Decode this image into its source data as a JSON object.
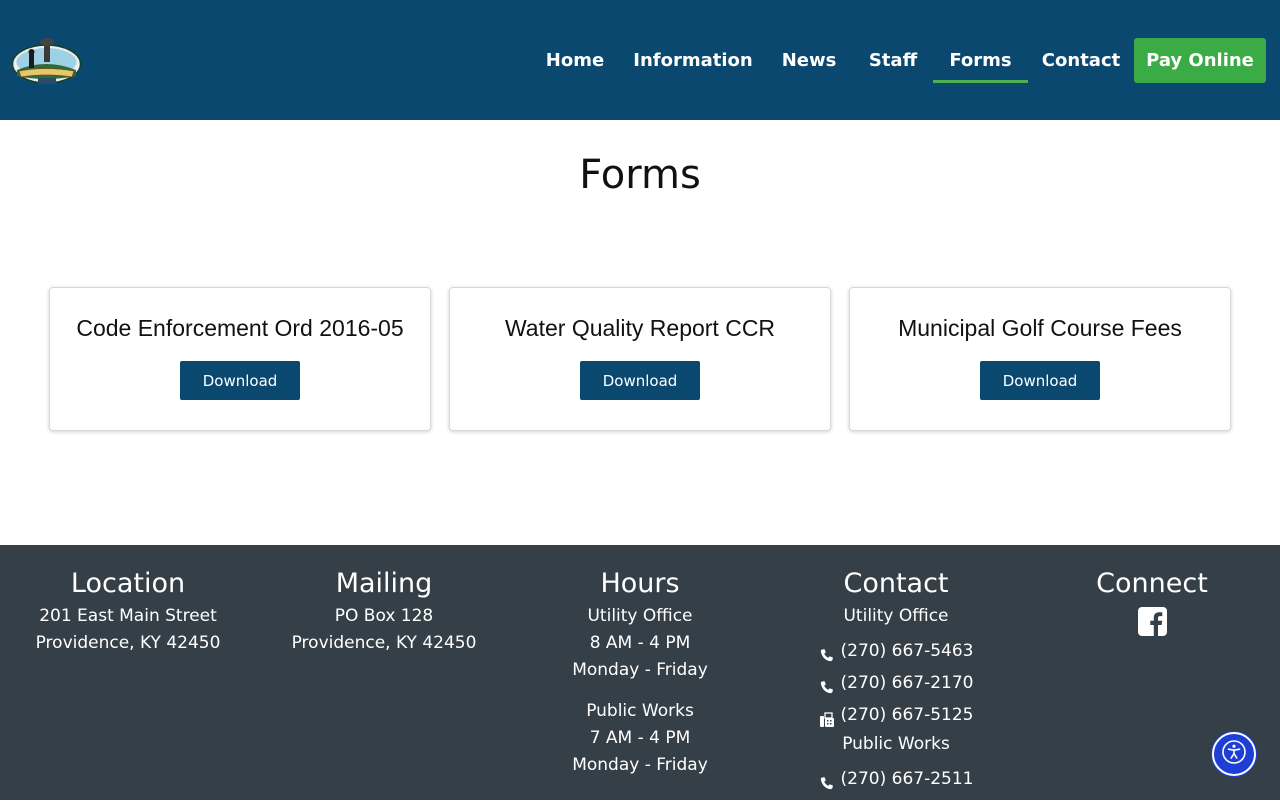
{
  "header": {
    "nav": [
      {
        "label": "Home"
      },
      {
        "label": "Information"
      },
      {
        "label": "News"
      },
      {
        "label": "Staff"
      },
      {
        "label": "Forms",
        "active": true
      },
      {
        "label": "Contact"
      }
    ],
    "pay_online": "Pay Online"
  },
  "main": {
    "title": "Forms",
    "cards": [
      {
        "title": "Code Enforcement Ord 2016-05",
        "button": "Download"
      },
      {
        "title": "Water Quality Report CCR",
        "button": "Download"
      },
      {
        "title": "Municipal Golf Course Fees",
        "button": "Download"
      }
    ]
  },
  "footer": {
    "location": {
      "heading": "Location",
      "lines": [
        "201 East Main Street",
        "Providence, KY 42450"
      ]
    },
    "mailing": {
      "heading": "Mailing",
      "lines": [
        "PO Box 128",
        "Providence, KY 42450"
      ]
    },
    "hours": {
      "heading": "Hours",
      "utility": [
        "Utility Office",
        "8 AM - 4 PM",
        "Monday - Friday"
      ],
      "public_works": [
        "Public Works",
        "7 AM - 4 PM",
        "Monday - Friday"
      ]
    },
    "contact": {
      "heading": "Contact",
      "utility_label": "Utility Office",
      "utility_phone_1": "(270) 667-5463",
      "utility_phone_2": "(270) 667-2170",
      "utility_fax": "(270) 667-5125",
      "public_works_label": "Public Works",
      "public_works_phone": "(270) 667-2511"
    },
    "connect": {
      "heading": "Connect",
      "icon": "facebook-icon"
    }
  },
  "colors": {
    "header_bg": "#0b4870",
    "pay_button": "#3aab45",
    "nav_active_underline": "#4caf50",
    "download_button": "#0b4870",
    "footer_bg": "#343f47",
    "accessibility_button": "#1e3fd6"
  },
  "icons": {
    "logo": "city-logo",
    "phone": "phone-icon",
    "fax": "fax-icon",
    "accessibility": "accessibility-icon"
  }
}
